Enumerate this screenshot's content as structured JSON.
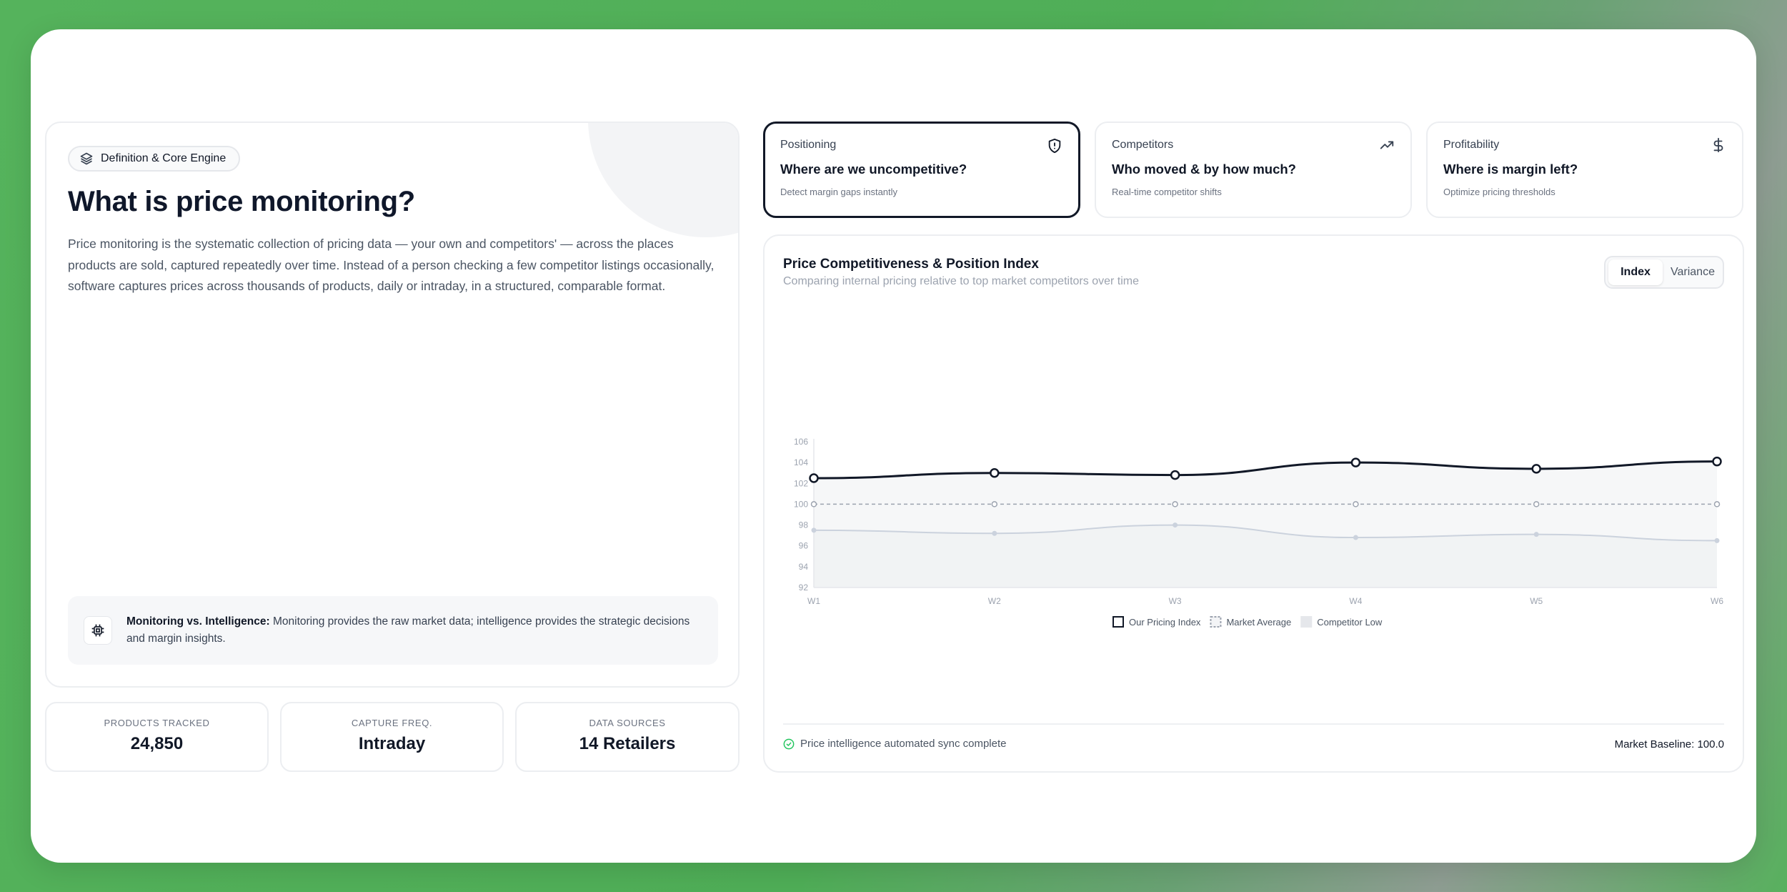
{
  "definition": {
    "badge_label": "Definition & Core Engine",
    "title": "What is price monitoring?",
    "description": "Price monitoring is the systematic collection of pricing data — your own and competitors' — across the places products are sold, captured repeatedly over time. Instead of a person checking a few competitor listings occasionally, software captures prices across thousands of products, daily or intraday, in a structured, comparable format.",
    "note_label": "Monitoring vs. Intelligence:",
    "note_text": "Monitoring provides the raw market data; intelligence provides the strategic decisions and margin insights."
  },
  "stats": [
    {
      "label": "PRODUCTS TRACKED",
      "value": "24,850"
    },
    {
      "label": "CAPTURE FREQ.",
      "value": "Intraday"
    },
    {
      "label": "DATA SOURCES",
      "value": "14 Retailers"
    }
  ],
  "cards": [
    {
      "category": "Positioning",
      "question": "Where are we uncompetitive?",
      "subtitle": "Detect margin gaps instantly",
      "icon": "shield-alert-icon",
      "active": true
    },
    {
      "category": "Competitors",
      "question": "Who moved & by how much?",
      "subtitle": "Real-time competitor shifts",
      "icon": "trending-up-icon",
      "active": false
    },
    {
      "category": "Profitability",
      "question": "Where is margin left?",
      "subtitle": "Optimize pricing thresholds",
      "icon": "dollar-icon",
      "active": false
    }
  ],
  "chart": {
    "title": "Price Competitiveness & Position Index",
    "subtitle": "Comparing internal pricing relative to top market competitors over time",
    "toggle": [
      "Index",
      "Variance"
    ],
    "toggle_selected": "Index",
    "sync_text": "Price intelligence automated sync complete",
    "baseline_text": "Market Baseline: 100.0"
  },
  "chart_data": {
    "type": "line",
    "categories": [
      "W1",
      "W2",
      "W3",
      "W4",
      "W5",
      "W6"
    ],
    "ylim": [
      92,
      106
    ],
    "yticks": [
      92,
      94,
      96,
      98,
      100,
      102,
      104,
      106
    ],
    "series": [
      {
        "name": "Our Pricing Index",
        "values": [
          102.5,
          103.0,
          102.8,
          104.0,
          103.4,
          104.1
        ],
        "color": "#111827",
        "style": "solid"
      },
      {
        "name": "Market Average",
        "values": [
          100,
          100,
          100,
          100,
          100,
          100
        ],
        "color": "#9ca3af",
        "style": "dashed"
      },
      {
        "name": "Competitor Low",
        "values": [
          97.5,
          97.2,
          98.0,
          96.8,
          97.1,
          96.5
        ],
        "color": "#cbd2dd",
        "style": "solid"
      }
    ],
    "legend_position": "bottom",
    "grid": false
  },
  "colors": {
    "accent_dark": "#111827",
    "border": "#eceef1",
    "sync_green": "#22c55e",
    "background_green": "#55b35c"
  }
}
